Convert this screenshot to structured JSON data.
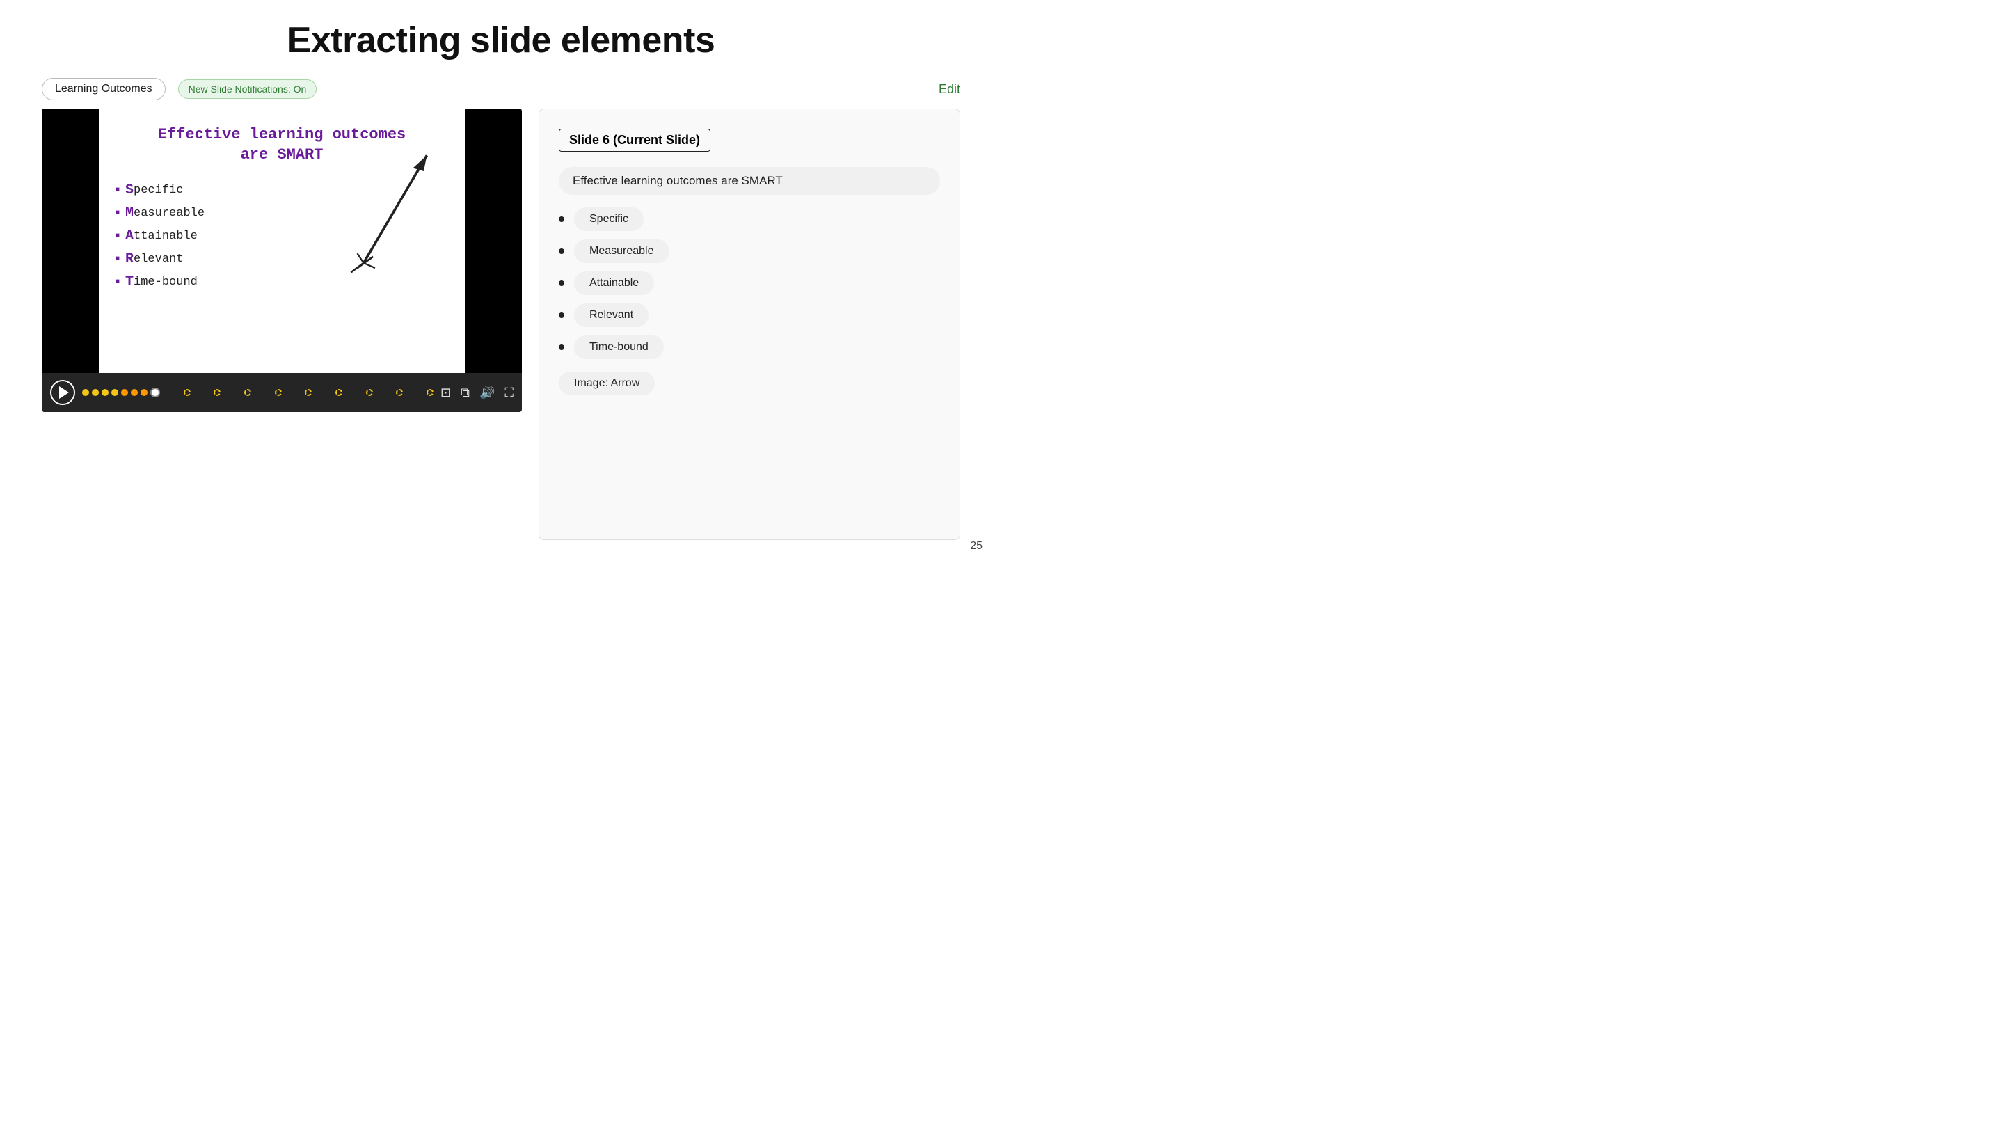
{
  "page": {
    "title": "Extracting slide elements",
    "page_number": "25"
  },
  "topbar": {
    "learning_outcomes_label": "Learning Outcomes",
    "notification_label": "New Slide Notifications: On",
    "edit_label": "Edit"
  },
  "slide": {
    "title": "Effective learning outcomes\nare SMART",
    "items": [
      {
        "letter": "S",
        "rest": "pecific"
      },
      {
        "letter": "M",
        "rest": "easureable"
      },
      {
        "letter": "A",
        "rest": "ttainable"
      },
      {
        "letter": "R",
        "rest": "elevant"
      },
      {
        "letter": "T",
        "rest": "ime-bound"
      }
    ]
  },
  "panel": {
    "header": "Slide 6 (Current Slide)",
    "title": "Effective learning outcomes are SMART",
    "items": [
      "Specific",
      "Measureable",
      "Attainable",
      "Relevant",
      "Time-bound"
    ],
    "image_label": "Image: Arrow"
  }
}
